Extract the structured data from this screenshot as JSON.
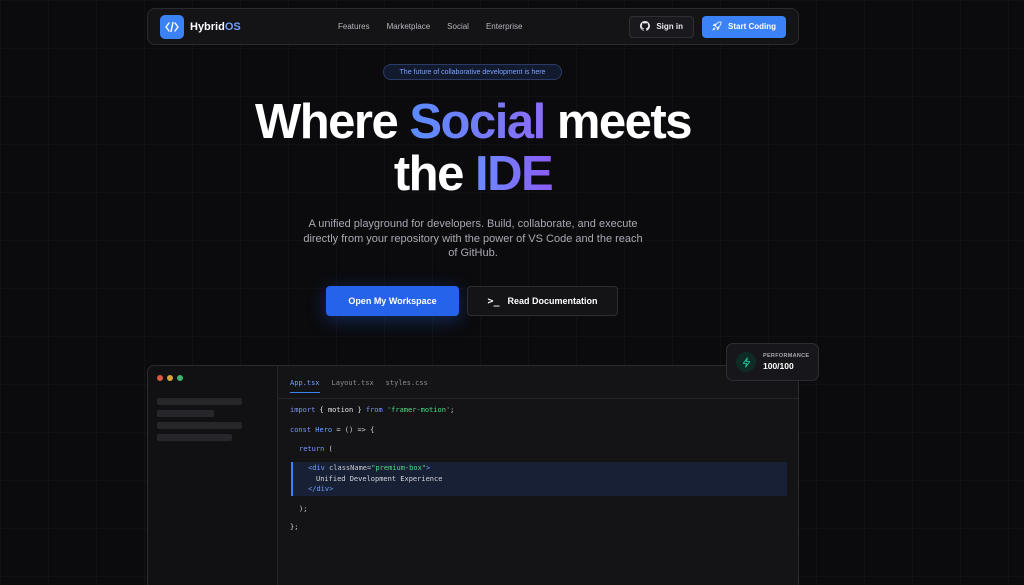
{
  "nav": {
    "logo_main": "Hybrid",
    "logo_accent": "OS",
    "links": [
      "Features",
      "Marketplace",
      "Social",
      "Enterprise"
    ],
    "signin_label": "Sign in",
    "start_label": "Start Coding"
  },
  "hero": {
    "pill": "The future of collaborative development is here",
    "headline_1": "Where",
    "headline_social": "Social",
    "headline_2": "meets",
    "headline_3": "the",
    "headline_ide": "IDE",
    "subtext": "A unified playground for developers. Build, collaborate, and execute directly from your repository with the power of VS Code and the reach of GitHub.",
    "cta_primary": "Open My Workspace",
    "cta_secondary": "Read Documentation",
    "cta_secondary_prompt": ">_"
  },
  "perf": {
    "label": "PERFORMANCE",
    "value": "100/100"
  },
  "editor": {
    "tabs": [
      "App.tsx",
      "Layout.tsx",
      "styles.css"
    ],
    "active_tab": "App.tsx",
    "code": {
      "l1_kw1": "import",
      "l1_mid": " { motion } ",
      "l1_kw2": "from",
      "l1_str": "'framer-motion'",
      "l1_end": ";",
      "l2_kw": "const",
      "l2_name": " Hero",
      "l2_rest": " = () => {",
      "l3_kw": "return",
      "l3_rest": " (",
      "l4_open": "<div",
      "l4_attr": " className=",
      "l4_str": "\"premium-box\"",
      "l4_close": ">",
      "l5_text": "Unified Development Experience",
      "l6_close_a": "</",
      "l6_tag": "div",
      "l6_close_b": ">",
      "l7": ");",
      "l8": "};"
    }
  },
  "colors": {
    "accent": "#3b82f6",
    "background": "#0b0b0e",
    "dot_red": "#e0583c",
    "dot_yellow": "#d9a13a",
    "dot_green": "#3cb371",
    "perf_icon": "#22c59e"
  }
}
